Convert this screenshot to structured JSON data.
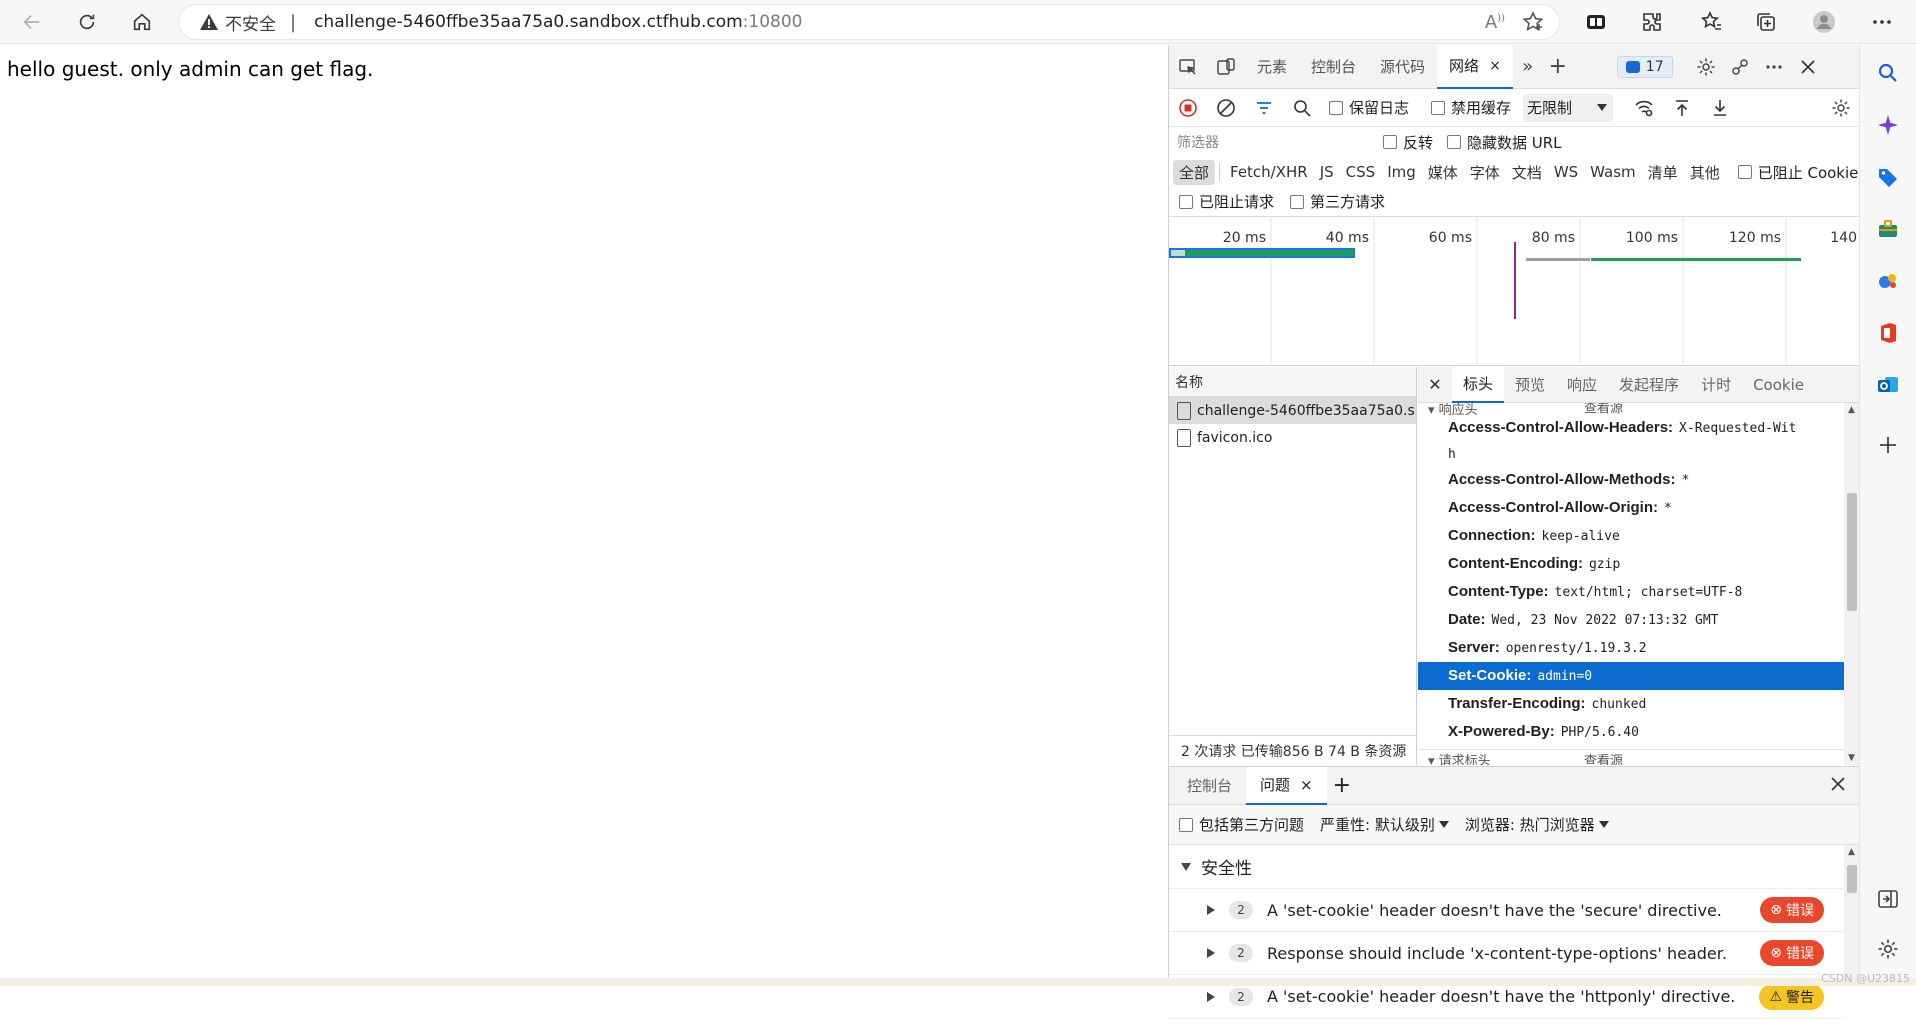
{
  "browser": {
    "insecure_label": "不安全",
    "separator": "|",
    "url_host": "challenge-5460ffbe35aa75a0.sandbox.ctfhub.com",
    "url_port": ":10800",
    "read_aloud": "A"
  },
  "page": {
    "text": "hello guest. only admin can get flag."
  },
  "devtools": {
    "tabs": [
      {
        "label": "元素"
      },
      {
        "label": "控制台"
      },
      {
        "label": "源代码"
      },
      {
        "label": "网络",
        "active": true
      }
    ],
    "close_tab_glyph": "×",
    "issues_count": "17",
    "toolbar": {
      "preserve_log": "保留日志",
      "disable_cache": "禁用缓存",
      "throttling": "无限制"
    },
    "filter": {
      "placeholder": "筛选器",
      "invert": "反转",
      "hide_data_urls": "隐藏数据 URL"
    },
    "types": [
      "全部",
      "Fetch/XHR",
      "JS",
      "CSS",
      "Img",
      "媒体",
      "字体",
      "文档",
      "WS",
      "Wasm",
      "清单",
      "其他"
    ],
    "blocked_cookies": "已阻止 Cookie",
    "blocked_requests": "已阻止请求",
    "third_party": "第三方请求",
    "timeline": {
      "ticks": [
        "20 ms",
        "40 ms",
        "60 ms",
        "80 ms",
        "100 ms",
        "120 ms",
        "140"
      ]
    },
    "request_list": {
      "column": "名称",
      "rows": [
        "challenge-5460ffbe35aa75a0.s...",
        "favicon.ico"
      ],
      "summary": "2 次请求  已传输856 B  74 B 条资源"
    },
    "detail": {
      "tabs": [
        "标头",
        "预览",
        "响应",
        "发起程序",
        "计时",
        "Cookie"
      ],
      "response_section": "响应头",
      "request_section": "请求标头",
      "view_source": "查看源",
      "headers": [
        {
          "key": "Access-Control-Allow-Headers:",
          "value": "X-Requested-Wit",
          "cont": "h"
        },
        {
          "key": "Access-Control-Allow-Methods:",
          "value": "*"
        },
        {
          "key": "Access-Control-Allow-Origin:",
          "value": "*"
        },
        {
          "key": "Connection:",
          "value": "keep-alive"
        },
        {
          "key": "Content-Encoding:",
          "value": "gzip"
        },
        {
          "key": "Content-Type:",
          "value": "text/html; charset=UTF-8"
        },
        {
          "key": "Date:",
          "value": "Wed, 23 Nov 2022 07:13:32 GMT"
        },
        {
          "key": "Server:",
          "value": "openresty/1.19.3.2"
        },
        {
          "key": "Set-Cookie:",
          "value": "admin=0",
          "selected": true
        },
        {
          "key": "Transfer-Encoding:",
          "value": "chunked"
        },
        {
          "key": "X-Powered-By:",
          "value": "PHP/5.6.40"
        }
      ]
    },
    "drawer": {
      "tabs": [
        "控制台",
        "问题"
      ],
      "include_third_party": "包括第三方问题",
      "severity": "严重性: 默认级别",
      "browser": "浏览器: 热门浏览器",
      "category": "安全性",
      "issues": [
        {
          "count": "2",
          "text": "A 'set-cookie' header doesn't have the 'secure' directive.",
          "level": "错误",
          "kind": "error"
        },
        {
          "count": "2",
          "text": "Response should include 'x-content-type-options' header.",
          "level": "错误",
          "kind": "error"
        },
        {
          "count": "2",
          "text": "A 'set-cookie' header doesn't have the 'httponly' directive.",
          "level": "警告",
          "kind": "warning"
        }
      ]
    }
  },
  "watermark": "CSDN @U23815",
  "colors": {
    "accent": "#0b6bcf",
    "error": "#e8472b",
    "warning": "#f2c524",
    "record": "#d93025"
  }
}
